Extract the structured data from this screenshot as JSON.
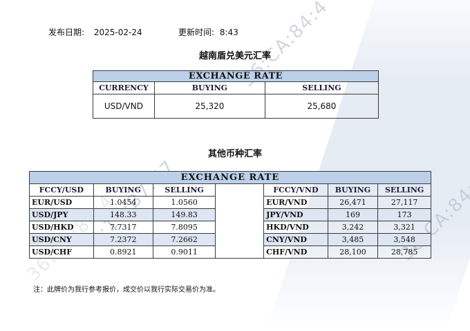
{
  "header": {
    "publish_label": "发布日期:",
    "publish_date": "2025-02-24",
    "update_label": "更新时间:",
    "update_time": "8:43"
  },
  "section1": {
    "title": "越南盾兑美元汇率",
    "table_caption": "EXCHANGE RATE",
    "columns": [
      "CURRENCY",
      "BUYING",
      "SELLING"
    ],
    "rows": [
      {
        "currency": "USD/VND",
        "buying": "25,320",
        "selling": "25,680"
      }
    ]
  },
  "section2": {
    "title": "其他币种汇率",
    "table_caption": "EXCHANGE  RATE",
    "left_columns": [
      "FCCY/USD",
      "BUYING",
      "SELLING"
    ],
    "right_columns": [
      "FCCY/VND",
      "BUYING",
      "SELLING"
    ],
    "left_rows": [
      {
        "pair": "EUR/USD",
        "buying": "1.0454",
        "selling": "1.0560"
      },
      {
        "pair": "USD/JPY",
        "buying": "148.33",
        "selling": "149.83"
      },
      {
        "pair": "USD/HKD",
        "buying": "7.7317",
        "selling": "7.8095"
      },
      {
        "pair": "USD/CNY",
        "buying": "7.2372",
        "selling": "7.2662"
      },
      {
        "pair": "USD/CHF",
        "buying": "0.8921",
        "selling": "0.9011"
      }
    ],
    "right_rows": [
      {
        "pair": "EUR/VND",
        "buying": "26,471",
        "selling": "27,117"
      },
      {
        "pair": "JPY/VND",
        "buying": "169",
        "selling": "173"
      },
      {
        "pair": "HKD/VND",
        "buying": "3,242",
        "selling": "3,321"
      },
      {
        "pair": "CNY/VND",
        "buying": "3,485",
        "selling": "3,548"
      },
      {
        "pair": "CHF/VND",
        "buying": "28,100",
        "selling": "28,785"
      }
    ]
  },
  "footnote": "注：此牌价为我行参考报价，成交价以我行实际交易价为准。",
  "watermarks": [
    "36:CA:84:4",
    "36:CA:84:4",
    "4:17:B7:57",
    "36:CA:84:4"
  ],
  "colors": {
    "header_fill": "#bcd0ea",
    "row_shade": "#dde6f2",
    "watermark_band": "#dee6f1"
  }
}
